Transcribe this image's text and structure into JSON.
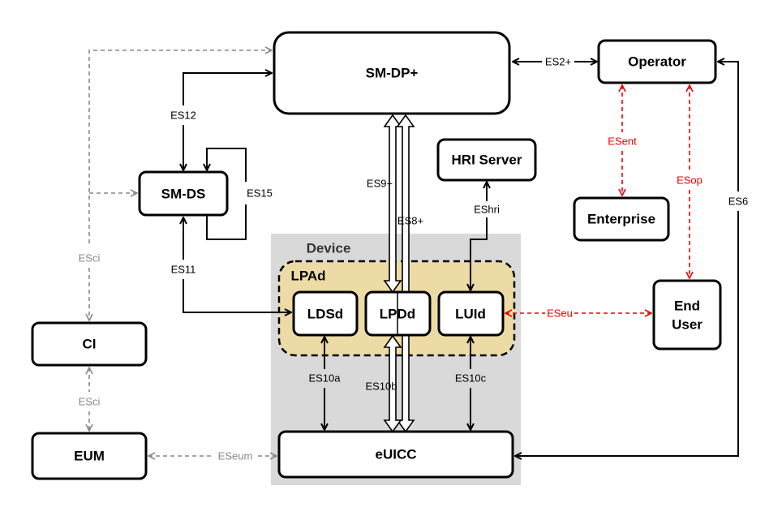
{
  "nodes": {
    "smdp": "SM-DP+",
    "operator": "Operator",
    "hri": "HRI Server",
    "smds": "SM-DS",
    "enterprise": "Enterprise",
    "device": "Device",
    "lpad": "LPAd",
    "ldsd": "LDSd",
    "lpdd": "LPDd",
    "luid": "LUId",
    "ci": "CI",
    "enduser_1": "End",
    "enduser_2": "User",
    "eum": "EUM",
    "euicc": "eUICC"
  },
  "interfaces": {
    "esci_top": "ESci",
    "esci_bottom": "ESci",
    "eseum": "ESeum",
    "es12": "ES12",
    "es15": "ES15",
    "es11": "ES11",
    "es9": "ES9+",
    "es8": "ES8+",
    "eshri": "EShri",
    "es10a": "ES10a",
    "es10b": "ES10b",
    "es10c": "ES10c",
    "eseu": "ESeu",
    "es2": "ES2+",
    "esent": "ESent",
    "esop": "ESop",
    "es6": "ES6"
  },
  "colors": {
    "device_bg": "#d9d9d9",
    "lpad_bg": "#eddba6",
    "user_links": "#e00000",
    "ci_links": "#888888"
  }
}
